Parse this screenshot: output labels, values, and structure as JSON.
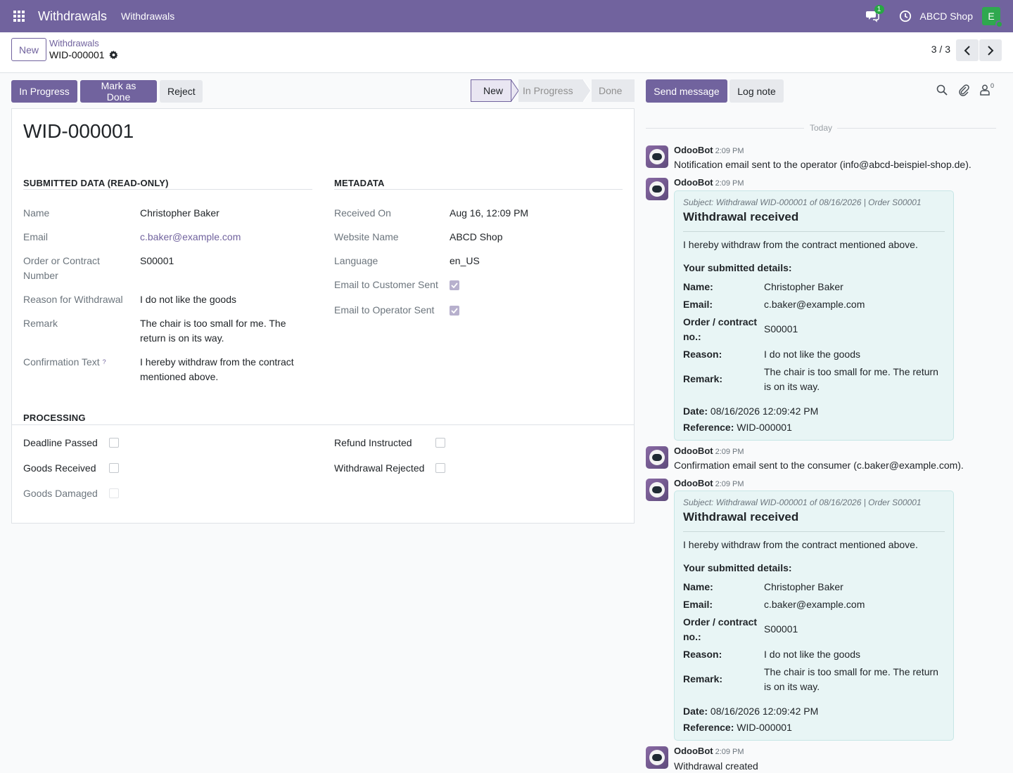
{
  "navbar": {
    "app_name": "Withdrawals",
    "menu_item": "Withdrawals",
    "chat_badge": "1",
    "company": "ABCD Shop",
    "avatar_letter": "E"
  },
  "control": {
    "new_button": "New",
    "breadcrumb_parent": "Withdrawals",
    "breadcrumb_current": "WID-000001",
    "pager": "3 / 3"
  },
  "statusbar": {
    "buttons": [
      "In Progress",
      "Mark as Done",
      "Reject"
    ],
    "stages": [
      "New",
      "In Progress",
      "Done"
    ]
  },
  "form": {
    "title": "WID-000001",
    "submitted": {
      "heading": "SUBMITTED DATA (READ-ONLY)",
      "name_label": "Name",
      "name": "Christopher Baker",
      "email_label": "Email",
      "email": "c.baker@example.com",
      "order_label_1": "Order or Contract",
      "order_label_2": "Number",
      "order": "S00001",
      "reason_label": "Reason for Withdrawal",
      "reason": "I do not like the goods",
      "remark_label": "Remark",
      "remark_1": "The chair is too small for me. The",
      "remark_2": "return is on its way.",
      "confirm_label": "Confirmation Text",
      "confirm_help": "?",
      "confirm_1": "I hereby withdraw from the contract",
      "confirm_2": "mentioned above."
    },
    "metadata": {
      "heading": "METADATA",
      "received_label": "Received On",
      "received": "Aug 16, 12:09 PM",
      "website_label": "Website Name",
      "website": "ABCD Shop",
      "language_label": "Language",
      "language": "en_US",
      "email_customer_label": "Email to Customer Sent",
      "email_operator_label": "Email to Operator Sent"
    },
    "processing": {
      "heading": "PROCESSING",
      "deadline_label": "Deadline Passed",
      "goods_received_label": "Goods Received",
      "goods_damaged_label": "Goods Damaged",
      "refund_label": "Refund Instructed",
      "rejected_label": "Withdrawal Rejected"
    }
  },
  "chatter": {
    "send_message": "Send message",
    "log_note": "Log note",
    "follower_count": "0",
    "today": "Today",
    "messages": [
      {
        "author": "OdooBot",
        "time": "2:09 PM",
        "text": "Notification email sent to the operator (info@abcd-beispiel-shop.de)."
      },
      {
        "author": "OdooBot",
        "time": "2:09 PM"
      },
      {
        "author": "OdooBot",
        "time": "2:09 PM",
        "text": "Confirmation email sent to the consumer (c.baker@example.com)."
      },
      {
        "author": "OdooBot",
        "time": "2:09 PM"
      },
      {
        "author": "OdooBot",
        "time": "2:09 PM",
        "text": "Withdrawal created"
      }
    ],
    "email": {
      "subject": "Subject: Withdrawal WID-000001 of 08/16/2026 | Order S00001",
      "title": "Withdrawal received",
      "intro": "I hereby withdraw from the contract mentioned above.",
      "details_heading": "Your submitted details:",
      "name_label": "Name:",
      "name": "Christopher Baker",
      "email_label": "Email:",
      "email": "c.baker@example.com",
      "order_label_1": "Order / contract",
      "order_label_2": "no.:",
      "order": "S00001",
      "reason_label": "Reason:",
      "reason": "I do not like the goods",
      "remark_label": "Remark:",
      "remark_1": "The chair is too small for me. The return",
      "remark_2": "is on its way.",
      "date_label": "Date:",
      "date": "08/16/2026 12:09:42 PM",
      "reference_label": "Reference:",
      "reference": "WID-000001"
    }
  },
  "colors": {
    "brand": "#71639e",
    "badge": "#28a745",
    "bubble": "#e8f5f5"
  }
}
